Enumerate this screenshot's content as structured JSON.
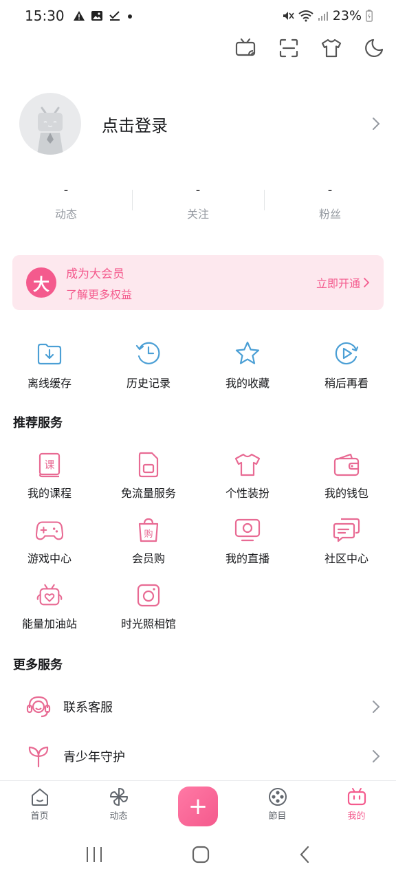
{
  "status_bar": {
    "time": "15:30",
    "battery": "23%"
  },
  "profile": {
    "login_label": "点击登录"
  },
  "stats": [
    {
      "value": "-",
      "label": "动态"
    },
    {
      "value": "-",
      "label": "关注"
    },
    {
      "value": "-",
      "label": "粉丝"
    }
  ],
  "vip": {
    "badge": "大",
    "title": "成为大会员",
    "subtitle": "了解更多权益",
    "action": "立即开通"
  },
  "quick_actions": [
    {
      "label": "离线缓存",
      "icon": "download-folder-icon"
    },
    {
      "label": "历史记录",
      "icon": "history-clock-icon"
    },
    {
      "label": "我的收藏",
      "icon": "star-icon"
    },
    {
      "label": "稍后再看",
      "icon": "play-later-icon"
    }
  ],
  "recommended": {
    "title": "推荐服务",
    "rows": [
      [
        {
          "label": "我的课程",
          "icon": "course-book-icon"
        },
        {
          "label": "免流量服务",
          "icon": "sim-card-icon"
        },
        {
          "label": "个性装扮",
          "icon": "tshirt-icon"
        },
        {
          "label": "我的钱包",
          "icon": "wallet-icon"
        }
      ],
      [
        {
          "label": "游戏中心",
          "icon": "gamepad-icon"
        },
        {
          "label": "会员购",
          "icon": "shopping-bag-icon"
        },
        {
          "label": "我的直播",
          "icon": "live-tv-icon"
        },
        {
          "label": "社区中心",
          "icon": "chat-bubbles-icon"
        }
      ],
      [
        {
          "label": "能量加油站",
          "icon": "heart-tv-icon"
        },
        {
          "label": "时光照相馆",
          "icon": "camera-icon"
        }
      ]
    ]
  },
  "more": {
    "title": "更多服务",
    "items": [
      {
        "label": "联系客服",
        "icon": "headset-icon"
      },
      {
        "label": "青少年守护",
        "icon": "sprout-icon"
      }
    ]
  },
  "bottom_nav": {
    "items": [
      {
        "label": "首页",
        "icon": "home-icon"
      },
      {
        "label": "动态",
        "icon": "pinwheel-icon"
      },
      {
        "label": "節目",
        "icon": "film-reel-icon"
      },
      {
        "label": "我的",
        "icon": "tv-mascot-icon"
      }
    ],
    "plus": "+",
    "active": "我的"
  },
  "colors": {
    "accent": "#f45a8d",
    "icon_blue": "#4b9fd5",
    "vip_bg": "#fde8ee"
  }
}
